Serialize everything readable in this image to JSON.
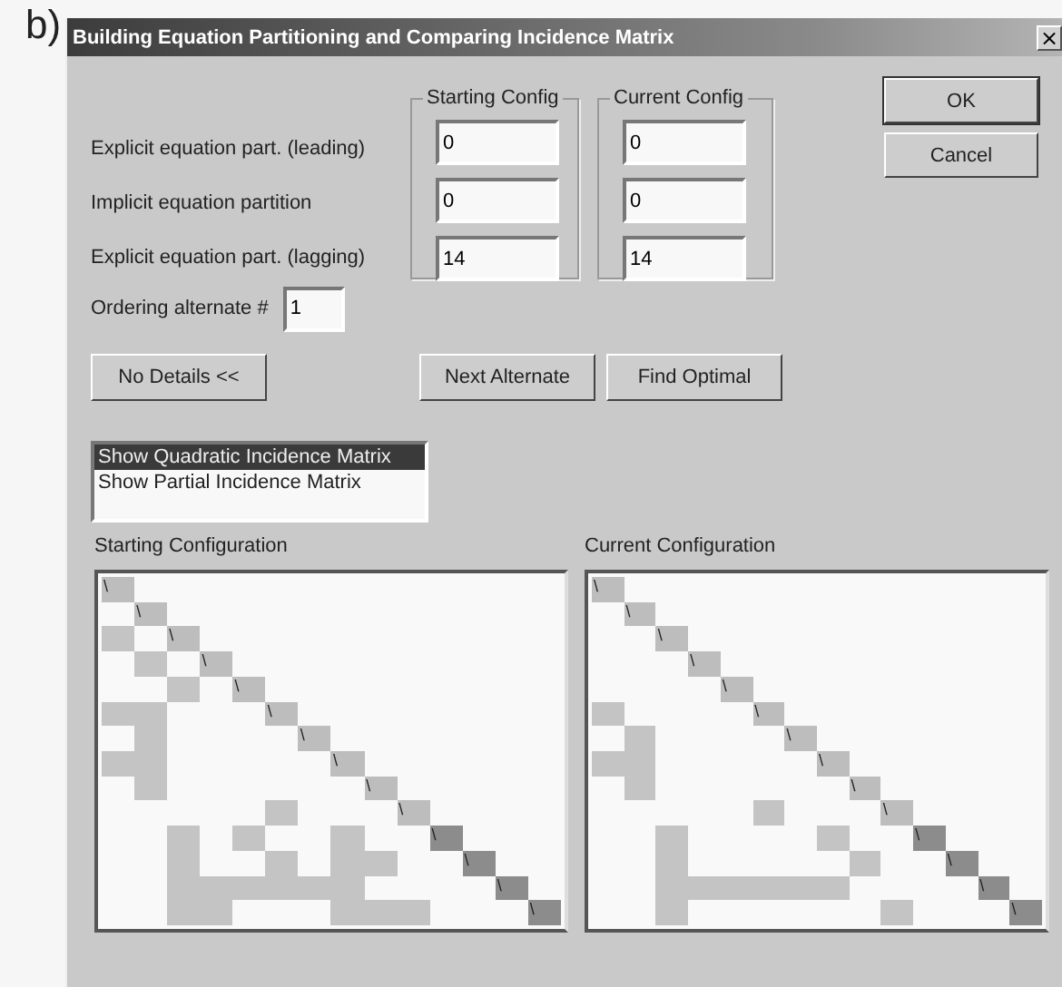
{
  "figure_label": "b)",
  "window": {
    "title": "Building Equation Partitioning and Comparing Incidence Matrix",
    "close": "×"
  },
  "groups": [
    "Starting Config",
    "Current Config"
  ],
  "fields": [
    {
      "label": "Explicit equation part. (leading)",
      "starting": "0",
      "current": "0"
    },
    {
      "label": "Implicit equation partition",
      "starting": "0",
      "current": "0"
    },
    {
      "label": "Explicit equation part. (lagging)",
      "starting": "14",
      "current": "14"
    }
  ],
  "ordering": {
    "label": "Ordering alternate #",
    "value": "1"
  },
  "dialog_buttons": [
    {
      "label": "OK",
      "kind": "default"
    },
    {
      "label": "Cancel",
      "kind": "normal"
    }
  ],
  "details_button": "No Details <<",
  "action_buttons": [
    "Next Alternate",
    "Find Optimal"
  ],
  "list": [
    {
      "label": "Show Quadratic Incidence Matrix",
      "selected": true
    },
    {
      "label": "Show Partial Incidence Matrix",
      "selected": false
    }
  ],
  "matrices": [
    {
      "title": "Starting Configuration",
      "mark": "\\",
      "rows": [
        {
          "diagonal_dark": false,
          "filled": [
            true,
            false,
            false,
            false,
            false,
            false,
            false,
            false,
            false,
            false,
            false,
            false,
            false,
            false
          ]
        },
        {
          "diagonal_dark": false,
          "filled": [
            false,
            true,
            false,
            false,
            false,
            false,
            false,
            false,
            false,
            false,
            false,
            false,
            false,
            false
          ]
        },
        {
          "diagonal_dark": false,
          "filled": [
            true,
            false,
            true,
            false,
            false,
            false,
            false,
            false,
            false,
            false,
            false,
            false,
            false,
            false
          ]
        },
        {
          "diagonal_dark": false,
          "filled": [
            false,
            true,
            false,
            true,
            false,
            false,
            false,
            false,
            false,
            false,
            false,
            false,
            false,
            false
          ]
        },
        {
          "diagonal_dark": false,
          "filled": [
            false,
            false,
            true,
            false,
            true,
            false,
            false,
            false,
            false,
            false,
            false,
            false,
            false,
            false
          ]
        },
        {
          "diagonal_dark": false,
          "filled": [
            true,
            true,
            false,
            false,
            false,
            true,
            false,
            false,
            false,
            false,
            false,
            false,
            false,
            false
          ]
        },
        {
          "diagonal_dark": false,
          "filled": [
            false,
            true,
            false,
            false,
            false,
            false,
            true,
            false,
            false,
            false,
            false,
            false,
            false,
            false
          ]
        },
        {
          "diagonal_dark": false,
          "filled": [
            true,
            true,
            false,
            false,
            false,
            false,
            false,
            true,
            false,
            false,
            false,
            false,
            false,
            false
          ]
        },
        {
          "diagonal_dark": false,
          "filled": [
            false,
            true,
            false,
            false,
            false,
            false,
            false,
            false,
            true,
            false,
            false,
            false,
            false,
            false
          ]
        },
        {
          "diagonal_dark": false,
          "filled": [
            false,
            false,
            false,
            false,
            false,
            true,
            false,
            false,
            false,
            true,
            false,
            false,
            false,
            false
          ]
        },
        {
          "diagonal_dark": true,
          "filled": [
            false,
            false,
            true,
            false,
            true,
            false,
            false,
            true,
            false,
            false,
            true,
            false,
            false,
            false
          ]
        },
        {
          "diagonal_dark": true,
          "filled": [
            false,
            false,
            true,
            false,
            false,
            true,
            false,
            true,
            true,
            false,
            false,
            true,
            false,
            false
          ]
        },
        {
          "diagonal_dark": true,
          "filled": [
            false,
            false,
            true,
            true,
            true,
            true,
            true,
            true,
            false,
            false,
            false,
            false,
            true,
            false
          ]
        },
        {
          "diagonal_dark": true,
          "filled": [
            false,
            false,
            true,
            true,
            false,
            false,
            false,
            true,
            true,
            true,
            false,
            false,
            false,
            true
          ]
        }
      ]
    },
    {
      "title": "Current Configuration",
      "mark": "\\",
      "rows": [
        {
          "diagonal_dark": false,
          "filled": [
            true,
            false,
            false,
            false,
            false,
            false,
            false,
            false,
            false,
            false,
            false,
            false,
            false,
            false
          ]
        },
        {
          "diagonal_dark": false,
          "filled": [
            false,
            true,
            false,
            false,
            false,
            false,
            false,
            false,
            false,
            false,
            false,
            false,
            false,
            false
          ]
        },
        {
          "diagonal_dark": false,
          "filled": [
            false,
            false,
            true,
            false,
            false,
            false,
            false,
            false,
            false,
            false,
            false,
            false,
            false,
            false
          ]
        },
        {
          "diagonal_dark": false,
          "filled": [
            false,
            false,
            false,
            true,
            false,
            false,
            false,
            false,
            false,
            false,
            false,
            false,
            false,
            false
          ]
        },
        {
          "diagonal_dark": false,
          "filled": [
            false,
            false,
            false,
            false,
            true,
            false,
            false,
            false,
            false,
            false,
            false,
            false,
            false,
            false
          ]
        },
        {
          "diagonal_dark": false,
          "filled": [
            true,
            false,
            false,
            false,
            false,
            true,
            false,
            false,
            false,
            false,
            false,
            false,
            false,
            false
          ]
        },
        {
          "diagonal_dark": false,
          "filled": [
            false,
            true,
            false,
            false,
            false,
            false,
            true,
            false,
            false,
            false,
            false,
            false,
            false,
            false
          ]
        },
        {
          "diagonal_dark": false,
          "filled": [
            true,
            true,
            false,
            false,
            false,
            false,
            false,
            true,
            false,
            false,
            false,
            false,
            false,
            false
          ]
        },
        {
          "diagonal_dark": false,
          "filled": [
            false,
            true,
            false,
            false,
            false,
            false,
            false,
            false,
            true,
            false,
            false,
            false,
            false,
            false
          ]
        },
        {
          "diagonal_dark": false,
          "filled": [
            false,
            false,
            false,
            false,
            false,
            true,
            false,
            false,
            false,
            true,
            false,
            false,
            false,
            false
          ]
        },
        {
          "diagonal_dark": true,
          "filled": [
            false,
            false,
            true,
            false,
            false,
            false,
            false,
            true,
            false,
            false,
            true,
            false,
            false,
            false
          ]
        },
        {
          "diagonal_dark": true,
          "filled": [
            false,
            false,
            true,
            false,
            false,
            false,
            false,
            false,
            true,
            false,
            false,
            true,
            false,
            false
          ]
        },
        {
          "diagonal_dark": true,
          "filled": [
            false,
            false,
            true,
            true,
            true,
            true,
            true,
            true,
            false,
            false,
            false,
            false,
            true,
            false
          ]
        },
        {
          "diagonal_dark": true,
          "filled": [
            false,
            false,
            true,
            false,
            false,
            false,
            false,
            false,
            false,
            true,
            false,
            false,
            false,
            true
          ]
        }
      ]
    }
  ]
}
